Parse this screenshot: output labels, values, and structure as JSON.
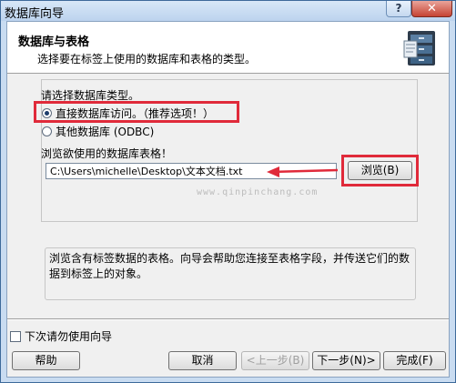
{
  "window": {
    "title": "数据库向导",
    "help_label": "?",
    "close_label": "✕"
  },
  "header": {
    "title": "数据库与表格",
    "subtitle": "选择要在标签上使用的数据库和表格的类型。",
    "icon": "filing-cabinet-database-icon"
  },
  "section": {
    "db_type_label": "请选择数据库类型。",
    "options": [
      {
        "label": "直接数据库访问。（推荐选项！）",
        "checked": true
      },
      {
        "label": "其他数据库 (ODBC)",
        "checked": false
      }
    ],
    "browse_table_label": "浏览欲使用的数据库表格！",
    "path_value": "C:\\Users\\michelle\\Desktop\\文本文档.txt",
    "browse_button": "浏览(B)"
  },
  "description": "浏览含有标签数据的表格。向导会帮助您连接至表格字段，并传送它们的数据到标签上的对象。",
  "watermark": "www.qinpinchang.com",
  "footer": {
    "dont_show_label": "下次请勿使用向导",
    "help_button": "帮助",
    "cancel_button": "取消",
    "prev_button": "<上一步(B)",
    "next_button": "下一步(N)>",
    "finish_button": "完成(F)"
  },
  "colors": {
    "highlight": "#e02a3a",
    "arrow": "#e02a3a"
  }
}
